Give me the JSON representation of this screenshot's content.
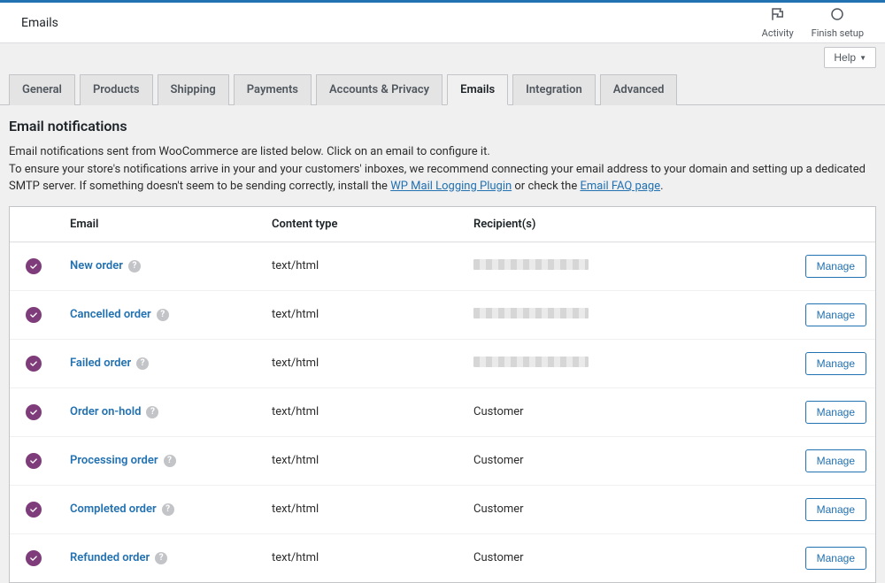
{
  "header": {
    "title": "Emails",
    "actions": {
      "activity": "Activity",
      "finish_setup": "Finish setup"
    },
    "help_label": "Help"
  },
  "tabs": [
    {
      "label": "General",
      "active": false
    },
    {
      "label": "Products",
      "active": false
    },
    {
      "label": "Shipping",
      "active": false
    },
    {
      "label": "Payments",
      "active": false
    },
    {
      "label": "Accounts & Privacy",
      "active": false
    },
    {
      "label": "Emails",
      "active": true
    },
    {
      "label": "Integration",
      "active": false
    },
    {
      "label": "Advanced",
      "active": false
    }
  ],
  "section": {
    "title": "Email notifications",
    "desc_line1": "Email notifications sent from WooCommerce are listed below. Click on an email to configure it.",
    "desc_line2a": "To ensure your store's notifications arrive in your and your customers' inboxes, we recommend connecting your email address to your domain and setting up a dedicated SMTP server. If something doesn't seem to be sending correctly, install the ",
    "desc_link1": "WP Mail Logging Plugin",
    "desc_line2b": " or check the ",
    "desc_link2": "Email FAQ page",
    "desc_line2c": "."
  },
  "table": {
    "headers": {
      "email": "Email",
      "content_type": "Content type",
      "recipients": "Recipient(s)"
    },
    "manage_label": "Manage",
    "rows": [
      {
        "name": "New order",
        "content_type": "text/html",
        "recipient": "",
        "redacted": true
      },
      {
        "name": "Cancelled order",
        "content_type": "text/html",
        "recipient": "",
        "redacted": true
      },
      {
        "name": "Failed order",
        "content_type": "text/html",
        "recipient": "",
        "redacted": true
      },
      {
        "name": "Order on-hold",
        "content_type": "text/html",
        "recipient": "Customer",
        "redacted": false
      },
      {
        "name": "Processing order",
        "content_type": "text/html",
        "recipient": "Customer",
        "redacted": false
      },
      {
        "name": "Completed order",
        "content_type": "text/html",
        "recipient": "Customer",
        "redacted": false
      },
      {
        "name": "Refunded order",
        "content_type": "text/html",
        "recipient": "Customer",
        "redacted": false
      }
    ]
  }
}
